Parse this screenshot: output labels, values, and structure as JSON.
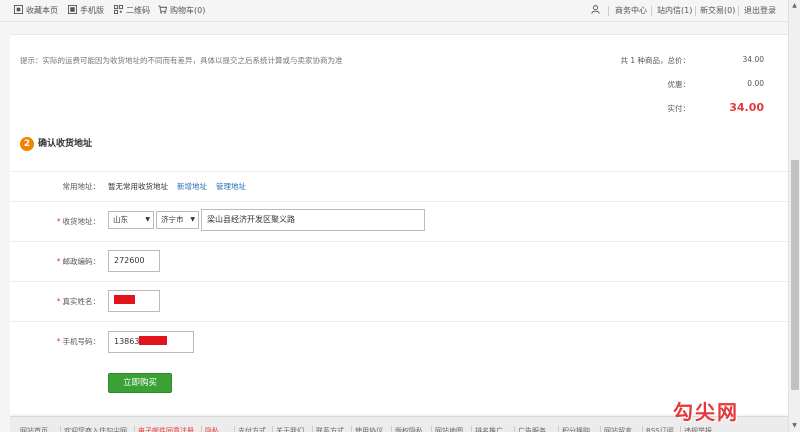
{
  "topbar": {
    "favorite": "收藏本页",
    "mobile": "手机版",
    "qrcode": "二维码",
    "cart": "购物车(0)",
    "member": "商务中心",
    "messages": "站内信(1)",
    "new_trade": "新交易(0)",
    "logout": "退出登录"
  },
  "summary": {
    "hint": "提示：实际的运费可能因为收货地址的不同而有差异，具体以提交之后系统计算或与卖家协商为准",
    "count_label": "共 1 种商品，总价：",
    "total": "34.00",
    "discount_label": "优惠：",
    "discount": "0.00",
    "pay_label": "实付：",
    "pay": "34.00"
  },
  "section": {
    "step": "2",
    "title": "确认收货地址"
  },
  "form": {
    "common_label": "常用地址：",
    "no_common": "暂无常用收货地址",
    "add_address": "新增地址",
    "manage_address": "管理地址",
    "region_label": "收货地址：",
    "province": "山东",
    "city": "济宁市",
    "street": "梁山县经济开发区聚义路",
    "zip_label": "邮政编码：",
    "zip": "272600",
    "name_label": "真实姓名：",
    "phone_label": "手机号码：",
    "phone_prefix": "13863",
    "submit": "立即购买"
  },
  "footer": {
    "links": [
      "网站首页",
      "欢迎您商入住勾尖网",
      "电子邮件同意注册",
      "隐私",
      "支付方式",
      "关于我们",
      "联系方式",
      "使用协议",
      "版权隐私",
      "网站地图",
      "排名推广",
      "广告服务",
      "积分换购",
      "网站留言",
      "RSS订阅",
      "违规举报"
    ]
  },
  "watermark": "勾尖网",
  "colors": {
    "accent_red": "#e4393c",
    "buy_green": "#3aa135",
    "link_blue": "#2a6fb5",
    "step_orange": "#f08300"
  }
}
